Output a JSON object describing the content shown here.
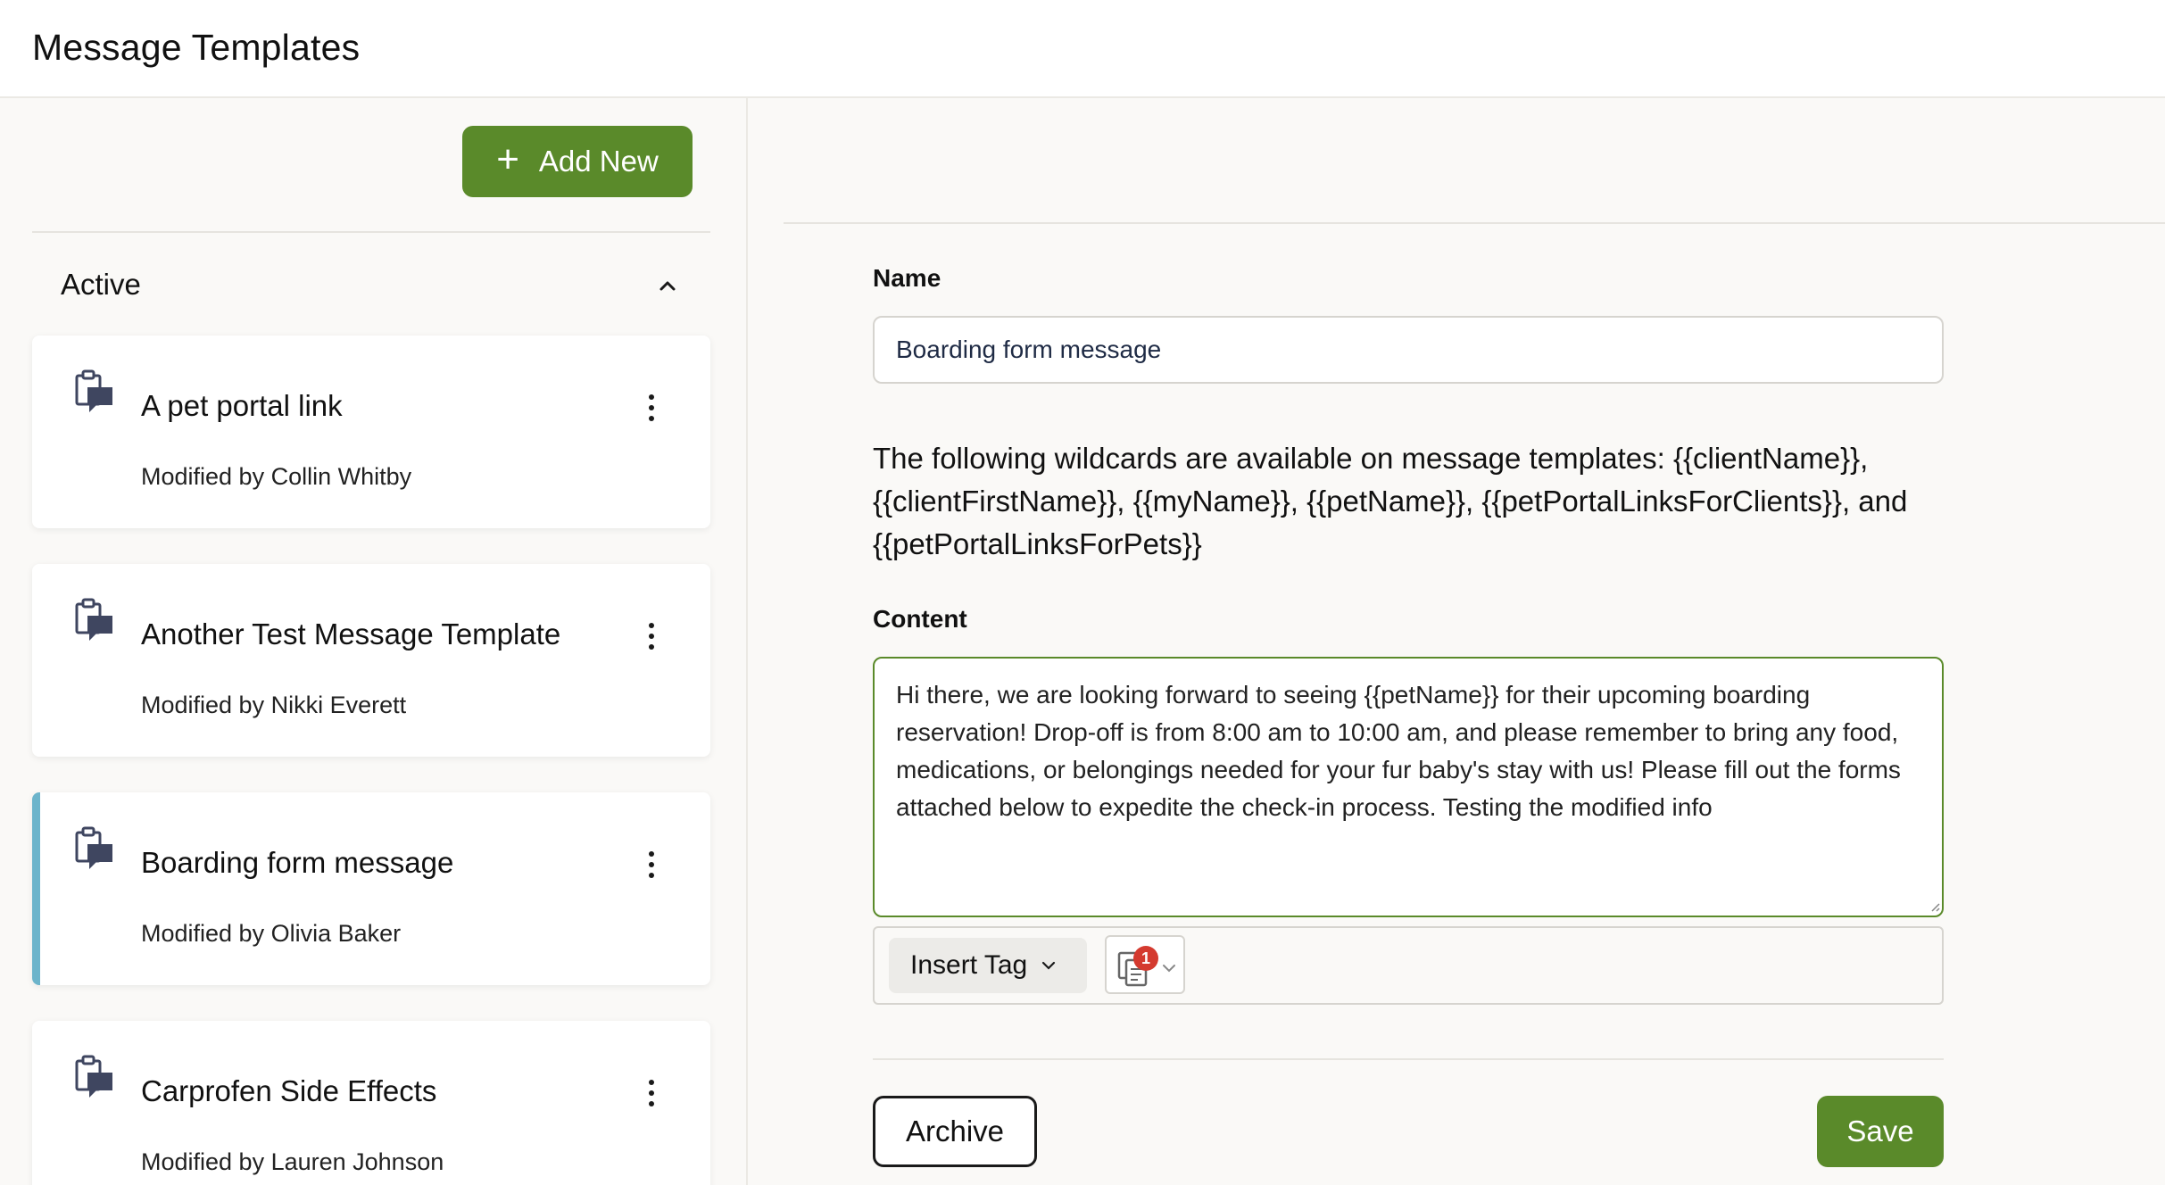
{
  "header": {
    "title": "Message Templates"
  },
  "sidebar": {
    "add_new_label": "Add New",
    "section_label": "Active",
    "items": [
      {
        "title": "A pet portal link",
        "subtitle": "Modified by Collin Whitby"
      },
      {
        "title": "Another Test Message Template",
        "subtitle": "Modified by Nikki Everett"
      },
      {
        "title": "Boarding form message",
        "subtitle": "Modified by Olivia Baker"
      },
      {
        "title": "Carprofen Side Effects",
        "subtitle": "Modified by Lauren Johnson"
      }
    ],
    "selected_index": 2
  },
  "form": {
    "name_label": "Name",
    "name_value": "Boarding form message",
    "wildcards_text": "The following wildcards are available on message templates: {{clientName}}, {{clientFirstName}}, {{myName}}, {{petName}}, {{petPortalLinksForClients}}, and {{petPortalLinksForPets}}",
    "content_label": "Content",
    "content_value": "Hi there, we are looking forward to seeing {{petName}} for their upcoming boarding reservation! Drop-off is from 8:00 am to 10:00 am, and please remember to bring any food, medications, or belongings needed for your fur baby's stay with us! Please fill out the forms attached below to expedite the check-in process. Testing the modified info",
    "insert_tag_label": "Insert Tag",
    "attachment_count": "1",
    "archive_label": "Archive",
    "save_label": "Save"
  },
  "colors": {
    "primary": "#5a8a2a",
    "selected_accent": "#6cb4cb",
    "badge": "#d43a2f"
  }
}
